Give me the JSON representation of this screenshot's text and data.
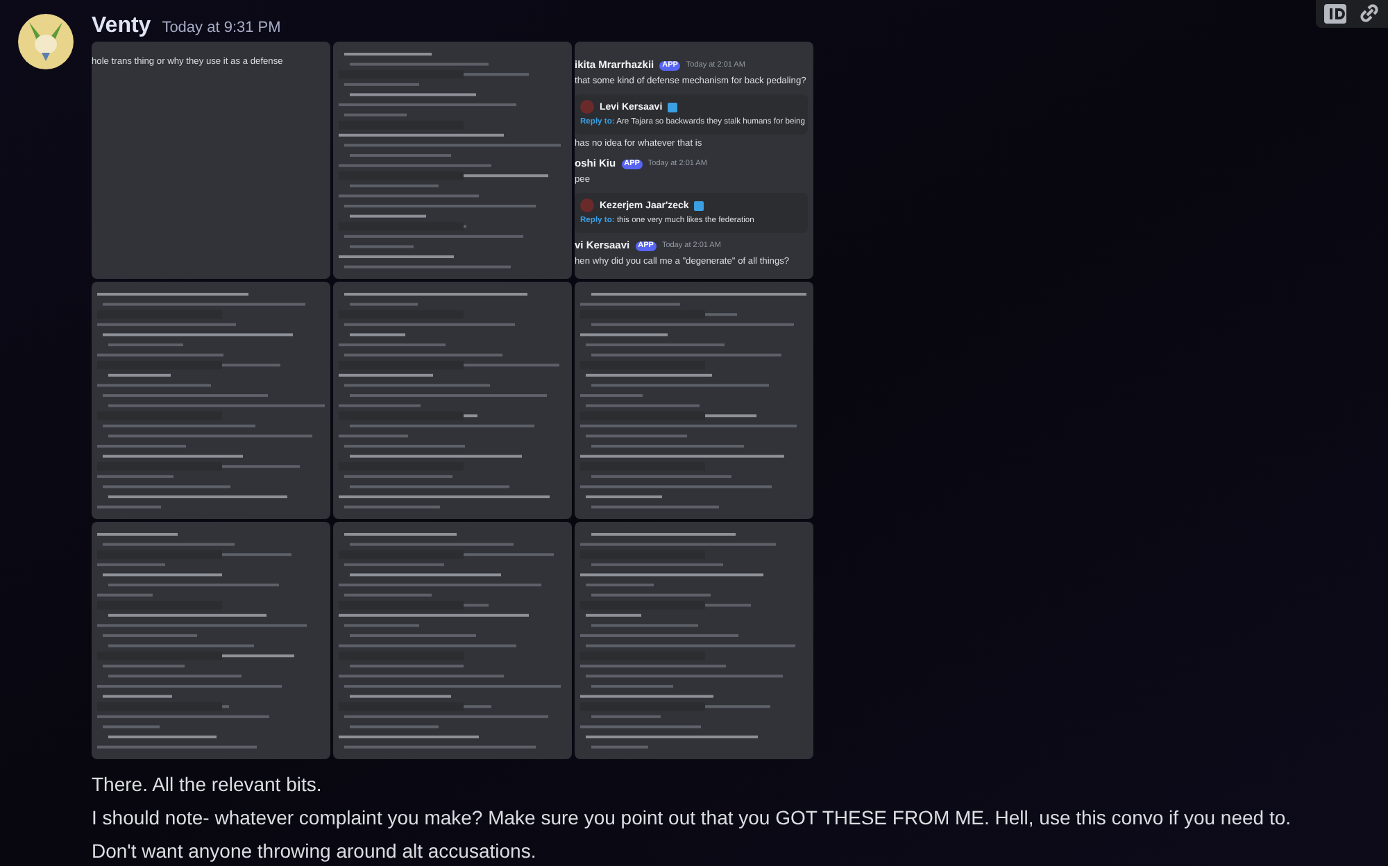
{
  "toolbar": {
    "buttons": [
      {
        "kind": "id"
      },
      {
        "kind": "link"
      }
    ]
  },
  "message": {
    "author": "Venty",
    "timestamp": "Today at 9:31 PM",
    "attachments": [
      {
        "kind": "chat",
        "lines": [
          {
            "text": "hole trans thing or why they use it as a defense"
          }
        ]
      },
      {
        "kind": "blurred"
      },
      {
        "kind": "chat",
        "lines": [
          {
            "author": "ikita Mrarrhazkii",
            "badge": "APP",
            "time": "Today at 2:01 AM"
          },
          {
            "text": "that some kind of defense mechanism for back pedaling?"
          },
          {
            "embed": {
              "author": "Levi Kersaavi",
              "reply_label": "Reply to:",
              "text": "Are Tajara so backwards they stalk humans for being"
            }
          },
          {
            "text": "has no idea for whatever that is"
          },
          {
            "author": "oshi Kiu",
            "badge": "APP",
            "time": "Today at 2:01 AM"
          },
          {
            "text": "pee"
          },
          {
            "embed": {
              "author": "Kezerjem Jaar'zeck",
              "reply_label": "Reply to:",
              "text": "this one very much likes the federation"
            }
          },
          {
            "author": "vi Kersaavi",
            "badge": "APP",
            "time": "Today at 2:01 AM"
          },
          {
            "text": "hen why did you call me a \"degenerate\" of all things?"
          }
        ]
      },
      {
        "kind": "blurred"
      },
      {
        "kind": "blurred"
      },
      {
        "kind": "blurred"
      },
      {
        "kind": "blurred"
      },
      {
        "kind": "blurred"
      },
      {
        "kind": "blurred"
      }
    ],
    "paragraphs": [
      "There. All the relevant bits.",
      "I should note- whatever complaint you make? Make sure you point out that you GOT THESE FROM ME. Hell, use this convo if you need to.",
      "Don't want anyone throwing around alt accusations."
    ]
  }
}
